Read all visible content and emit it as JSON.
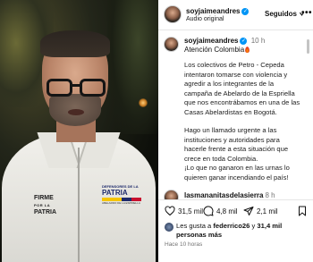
{
  "header": {
    "username": "soyjaimeandres",
    "subtitle": "Audio original",
    "follow_label": "Seguidos",
    "more_label": "•••"
  },
  "caption": {
    "username": "soyjaimeandres",
    "time": "10 h",
    "title": "Atención Colombia",
    "paragraphs": [
      "Los colectivos de Petro - Cepeda intentaron tomarse con violencia y agredir a los integrantes de la campaña de Abelardo de la Espriella que nos encontrábamos en una de las Casas Abelardistas en Bogotá.",
      "Hago un llamado urgente a las instituciones y autoridades para hacerle frente a esta situación que crece en toda Colombia.",
      "¡Lo que no ganaron en las urnas lo quieren ganar incendiando el país!"
    ]
  },
  "comment": {
    "username": "lasmananitasdelasierra",
    "time": "8 h"
  },
  "actions": {
    "likes": "31,5 mil",
    "comments": "4,8 mil",
    "shares": "2,1 mil"
  },
  "liked_by": {
    "prefix": "Les gusta a",
    "user": "federrico26",
    "connector": "y",
    "count": "31,4 mil personas más"
  },
  "posted_ago": "Hace 10 horas",
  "video": {
    "patch_left_top": "FIRME",
    "patch_left_mid": "POR LA",
    "patch_left_bottom": "PATRIA",
    "patch_right_top": "DEFENSORES DE LA",
    "patch_right_main": "PATRIA",
    "patch_right_small": "ABELARDO DE LA ESPRIELLA"
  },
  "colors": {
    "verified": "#0095f6",
    "secondary_text": "#737373"
  }
}
